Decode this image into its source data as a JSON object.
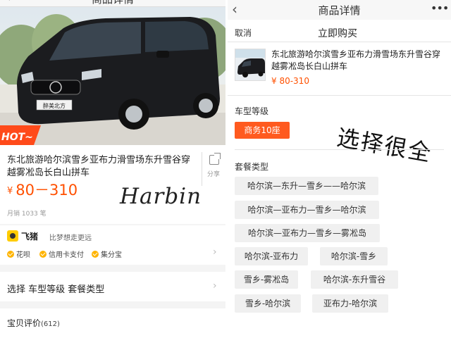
{
  "left": {
    "header": {
      "back_icon": "back-chevron-icon",
      "title": "商品详情"
    },
    "hot_tag": "HOT~",
    "hero_car_plate": "醉美北方",
    "product": {
      "title": "东北旅游哈尔滨雪乡亚布力滑雪场东升雪谷穿越雾凇岛长白山拼车",
      "price_symbol": "¥",
      "price": "80－310",
      "sales": "月销 1033 笔",
      "share_label": "分享"
    },
    "overlay_text": "Harbin",
    "payment": {
      "brand": "飞猪",
      "slogan": "比梦想走更远",
      "options": [
        "花呗",
        "信用卡支付",
        "集分宝"
      ]
    },
    "select_row": "选择 车型等级 套餐类型",
    "reviews": {
      "label": "宝贝评价",
      "count": "(612)"
    }
  },
  "right": {
    "header": {
      "back_icon": "back-chevron-icon",
      "title": "商品详情",
      "more_icon": "more-dots-icon"
    },
    "buybar": {
      "cancel": "取消",
      "buy_now": "立即购买"
    },
    "product": {
      "title": "东北旅游哈尔滨雪乡亚布力滑雪场东升雪谷穿越雾凇岛长白山拼车",
      "price": "¥ 80-310"
    },
    "car_level": {
      "title": "车型等级",
      "selected": "商务10座"
    },
    "handwritten_note": "选择很全",
    "package": {
      "title": "套餐类型",
      "options": [
        "哈尔滨—东升—雪乡——哈尔滨",
        "哈尔滨—亚布力—雪乡—哈尔滨",
        "哈尔滨—亚布力—雪乡—雾凇岛",
        "哈尔滨-亚布力",
        "哈尔滨-雪乡",
        "雪乡-雾凇岛",
        "哈尔滨-东升雪谷",
        "雪乡-哈尔滨",
        "亚布力-哈尔滨"
      ]
    }
  },
  "colors": {
    "accent": "#ff5000",
    "tag_selected": "#ff5a1f",
    "option_bg": "#f0f0f0"
  }
}
